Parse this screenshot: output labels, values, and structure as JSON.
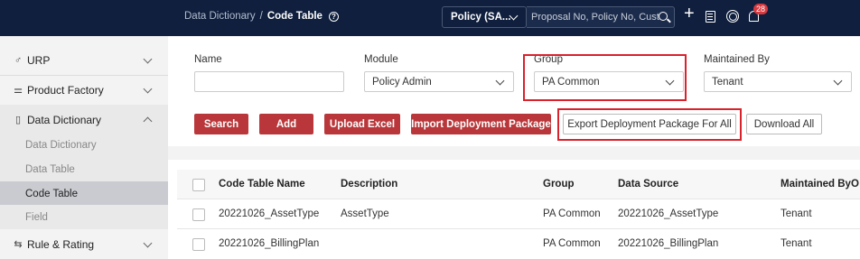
{
  "header": {
    "breadcrumb_parent": "Data Dictionary",
    "breadcrumb_sep": "/",
    "breadcrumb_current": "Code Table",
    "policy_select": "Policy (SA...",
    "search_placeholder": "Proposal No, Policy No, Cust",
    "notification_count": "28"
  },
  "sidebar": {
    "items": [
      {
        "label": "URP",
        "icon": "urp-icon"
      },
      {
        "label": "Product Factory",
        "icon": "sliders-icon"
      },
      {
        "label": "Data Dictionary",
        "icon": "document-icon"
      },
      {
        "label": "Rule & Rating",
        "icon": "rule-icon"
      }
    ],
    "subitems": [
      {
        "label": "Data Dictionary"
      },
      {
        "label": "Data Table"
      },
      {
        "label": "Code Table"
      },
      {
        "label": "Field"
      }
    ]
  },
  "filters": {
    "name_label": "Name",
    "name_value": "",
    "module_label": "Module",
    "module_value": "Policy Admin",
    "group_label": "Group",
    "group_value": "PA Common",
    "maintained_label": "Maintained By",
    "maintained_value": "Tenant"
  },
  "buttons": {
    "search": "Search",
    "add": "Add",
    "upload": "Upload Excel",
    "import": "Import Deployment Package",
    "export": "Export Deployment Package For All",
    "download": "Download All"
  },
  "table": {
    "columns": [
      "Code Table Name",
      "Description",
      "Group",
      "Data Source",
      "Maintained By",
      "O"
    ],
    "rows": [
      [
        "20221026_AssetType",
        "AssetType",
        "PA Common",
        "20221026_AssetType",
        "Tenant"
      ],
      [
        "20221026_BillingPlan",
        "",
        "PA Common",
        "20221026_BillingPlan",
        "Tenant"
      ]
    ]
  },
  "colors": {
    "topbar": "#0f1f3d",
    "primary_button": "#b9373a",
    "highlight_box": "#d9222b",
    "badge": "#d7393f"
  }
}
